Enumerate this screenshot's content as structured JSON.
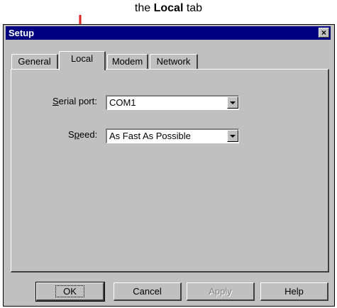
{
  "caption": {
    "prefix": "the ",
    "bold": "Local",
    "suffix": " tab"
  },
  "window": {
    "title": "Setup",
    "close_glyph": "×"
  },
  "tabs": [
    {
      "label": "General",
      "active": false
    },
    {
      "label": "Local",
      "active": true
    },
    {
      "label": "Modem",
      "active": false
    },
    {
      "label": "Network",
      "active": false
    }
  ],
  "fields": {
    "serial_port": {
      "label_mnemonic": "S",
      "label_rest": "erial port:",
      "value": "COM1"
    },
    "speed": {
      "label_pre": "S",
      "label_mnemonic": "p",
      "label_rest": "eed:",
      "value": "As Fast As Possible"
    }
  },
  "buttons": {
    "ok": "OK",
    "cancel": "Cancel",
    "apply": "Apply",
    "help": "Help"
  },
  "colors": {
    "annotation": "#e02020",
    "titlebar": "#000080",
    "face": "#c0c0c0"
  },
  "icons": {
    "close": "close-icon",
    "pointer": "red-arrow-icon",
    "highlight": "red-ellipse-annotation"
  }
}
